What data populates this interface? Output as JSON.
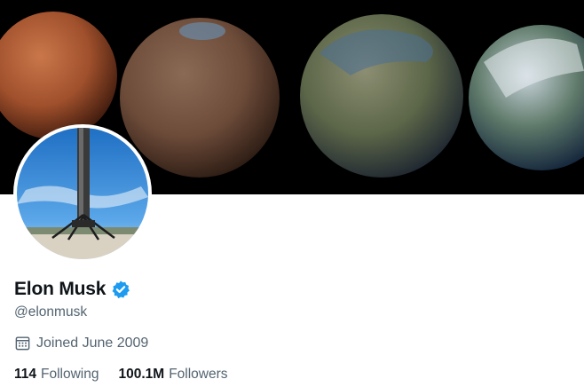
{
  "profile": {
    "display_name": "Elon Musk",
    "handle": "@elonmusk",
    "verified": true,
    "joined": "Joined June 2009",
    "stats": {
      "following_count": "114",
      "following_label": "Following",
      "followers_count": "100.1M",
      "followers_label": "Followers"
    }
  },
  "icons": {
    "verified": "verified-badge-icon",
    "calendar": "calendar-icon"
  },
  "colors": {
    "text_primary": "#0f1419",
    "text_secondary": "#536471",
    "verified_blue": "#1d9bf0",
    "banner_background": "#000000"
  }
}
